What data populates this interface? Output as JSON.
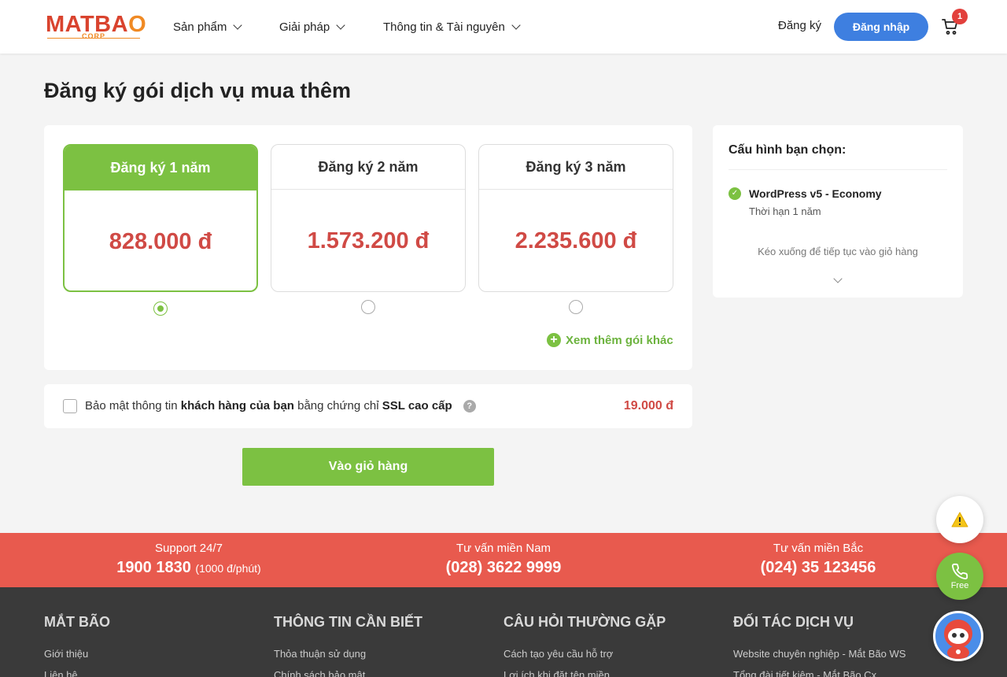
{
  "header": {
    "logo_text_a": "MATBA",
    "logo_text_b": "O",
    "logo_sub": "CORP",
    "nav": [
      {
        "label": "Sản phẩm"
      },
      {
        "label": "Giải pháp"
      },
      {
        "label": "Thông tin & Tài nguyên"
      }
    ],
    "register_label": "Đăng ký",
    "login_label": "Đăng nhập",
    "cart_count": "1"
  },
  "page": {
    "title": "Đăng ký gói dịch vụ mua thêm"
  },
  "plans": [
    {
      "label": "Đăng ký 1 năm",
      "price": "828.000 đ",
      "selected": true
    },
    {
      "label": "Đăng ký 2 năm",
      "price": "1.573.200 đ",
      "selected": false
    },
    {
      "label": "Đăng ký 3 năm",
      "price": "2.235.600 đ",
      "selected": false
    }
  ],
  "more_plans_label": "Xem thêm gói khác",
  "ssl": {
    "text_a": "Bảo mật thông tin ",
    "text_b": "khách hàng của bạn",
    "text_c": " bằng chứng chỉ ",
    "text_d": "SSL cao cấp",
    "help": "?",
    "price": "19.000 đ"
  },
  "add_to_cart_label": "Vào giỏ hàng",
  "summary": {
    "title": "Cấu hình bạn chọn:",
    "item_name": "WordPress v5 - Economy",
    "item_term": "Thời hạn 1 năm",
    "hint": "Kéo xuống để tiếp tục vào giỏ hàng"
  },
  "contacts": [
    {
      "label": "Support 24/7",
      "number": "1900 1830",
      "note": "(1000 đ/phút)"
    },
    {
      "label": "Tư vấn miền Nam",
      "number": "(028) 3622 9999",
      "note": ""
    },
    {
      "label": "Tư vấn miền Bắc",
      "number": "(024) 35 123456",
      "note": ""
    }
  ],
  "footer": [
    {
      "title": "MẮT BÃO",
      "link1": "Giới thiệu",
      "link2": "Liên hệ"
    },
    {
      "title": "THÔNG TIN CẦN BIẾT",
      "link1": "Thỏa thuận sử dụng",
      "link2": "Chính sách bảo mật"
    },
    {
      "title": "CÂU HỎI THƯỜNG GẶP",
      "link1": "Cách tạo yêu cầu hỗ trợ",
      "link2": "Lợi ích khi đặt tên miền"
    },
    {
      "title": "ĐỐI TÁC DỊCH VỤ",
      "link1": "Website chuyên nghiệp - Mắt Bão WS",
      "link2": "Tổng đài tiết kiệm - Mắt Bão Cx"
    }
  ],
  "phone_free_label": "Free",
  "colors": {
    "accent_green": "#7cc142",
    "primary_blue": "#3e7fe0",
    "price_red": "#d04a45",
    "contact_bar": "#e85a4e",
    "footer_bg": "#3a3a3a"
  }
}
